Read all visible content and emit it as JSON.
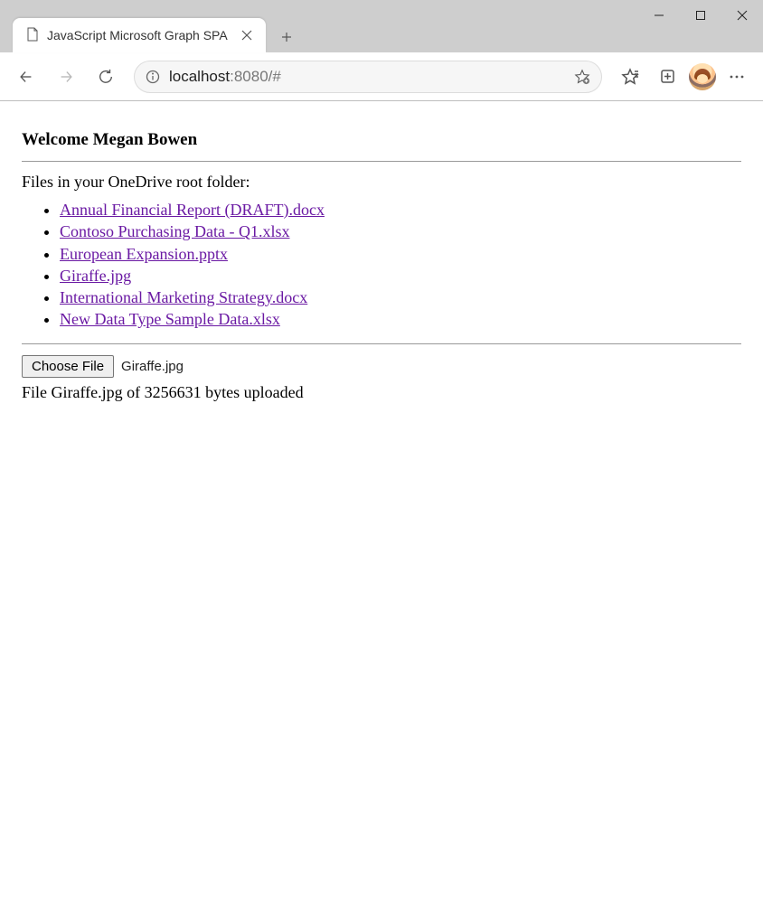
{
  "browser": {
    "tab_title": "JavaScript Microsoft Graph SPA",
    "url_host": "localhost",
    "url_rest": ":8080/#"
  },
  "page": {
    "welcome_prefix": "Welcome ",
    "user_name": "Megan Bowen",
    "files_heading": "Files in your OneDrive root folder:",
    "files": [
      "Annual Financial Report (DRAFT).docx",
      "Contoso Purchasing Data - Q1.xlsx",
      "European Expansion.pptx",
      "Giraffe.jpg",
      "International Marketing Strategy.docx",
      "New Data Type Sample Data.xlsx"
    ],
    "choose_file_label": "Choose File",
    "chosen_file": "Giraffe.jpg",
    "upload_status": "File Giraffe.jpg of 3256631 bytes uploaded"
  }
}
